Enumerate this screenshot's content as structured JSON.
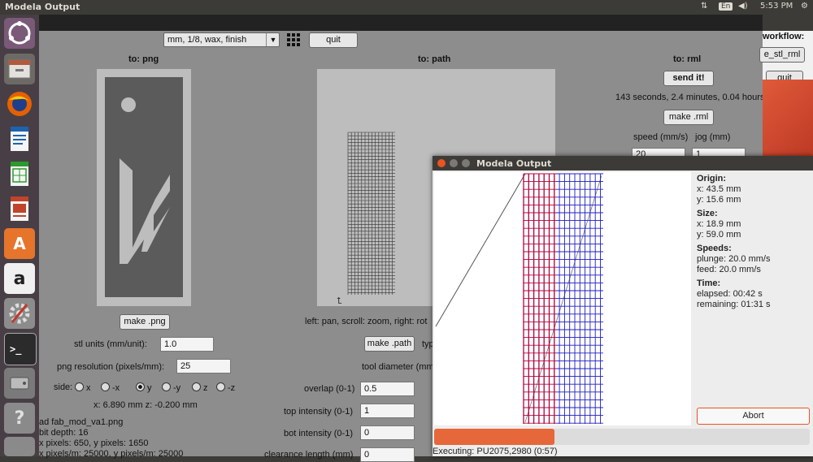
{
  "topbar": {
    "title": "Modela Output",
    "lang": "En",
    "time": "5:53 PM"
  },
  "launcher": {
    "items": [
      "ubuntu-icon",
      "files-icon",
      "firefox-icon",
      "writer-icon",
      "calc-icon",
      "impress-icon",
      "software-icon",
      "amazon-icon",
      "settings-icon",
      "terminal-icon",
      "disk-icon",
      "help-icon"
    ]
  },
  "toolbar": {
    "process_select": "mm, 1/8, wax, finish",
    "quit_label": "quit"
  },
  "png_panel": {
    "heading": "to: png",
    "make_png": "make .png",
    "stl_units_label": "stl units (mm/unit):",
    "stl_units_value": "1.0",
    "png_res_label": "png resolution (pixels/mm):",
    "png_res_value": "25",
    "side_label": "side:",
    "sides": [
      "x",
      "-x",
      "y",
      "-y",
      "z",
      "-z"
    ],
    "side_selected": "y",
    "coords": "x: 6.890 mm  z: -0.200 mm",
    "info_lines": [
      "ad fab_mod_va1.png",
      "bit depth: 16",
      "x pixels: 650, y pixels: 1650",
      "x pixels/m: 25000, y pixels/m: 25000"
    ]
  },
  "path_panel": {
    "heading": "to: path",
    "hint": "left: pan, scroll: zoom, right: rot",
    "make_path": "make .path",
    "type_label": "typ",
    "tool_diameter_label": "tool diameter (mm",
    "overlap_label": "overlap (0-1)",
    "overlap_value": "0.5",
    "top_intensity_label": "top intensity (0-1)",
    "top_intensity_value": "1",
    "bot_intensity_label": "bot intensity (0-1)",
    "bot_intensity_value": "0",
    "clearance_label": "clearance length (mm)",
    "clearance_value": "0"
  },
  "rml_panel": {
    "heading": "to: rml",
    "send_label": "send it!",
    "estimate": "143 seconds, 2.4 minutes, 0.04 hours",
    "make_rml": "make .rml",
    "speed_label": "speed (mm/s)",
    "jog_label": "jog (mm)",
    "speed_value": "20",
    "jog_value": "1"
  },
  "right_strip": {
    "workflow_label": "workflow:",
    "stl_rml_label": "e_stl_rml",
    "quit_label": "quit"
  },
  "output_window": {
    "title": "Modela Output",
    "origin_head": "Origin:",
    "origin_x": "x: 43.5 mm",
    "origin_y": "y: 15.6 mm",
    "size_head": "Size:",
    "size_x": "x: 18.9 mm",
    "size_y": "y: 59.0 mm",
    "speeds_head": "Speeds:",
    "plunge": "plunge: 20.0 mm/s",
    "feed": "feed: 20.0 mm/s",
    "time_head": "Time:",
    "elapsed": "elapsed: 00:42 s",
    "remaining": "remaining: 01:31 s",
    "abort_label": "Abort",
    "progress": 0.32,
    "status": "Executing: PU2075,2980 (0:57)"
  },
  "colors": {
    "cut_red": "#b0003a",
    "cut_blue": "#1c1cc8",
    "progress": "#e6673a",
    "accent_orange": "#dd4814"
  }
}
